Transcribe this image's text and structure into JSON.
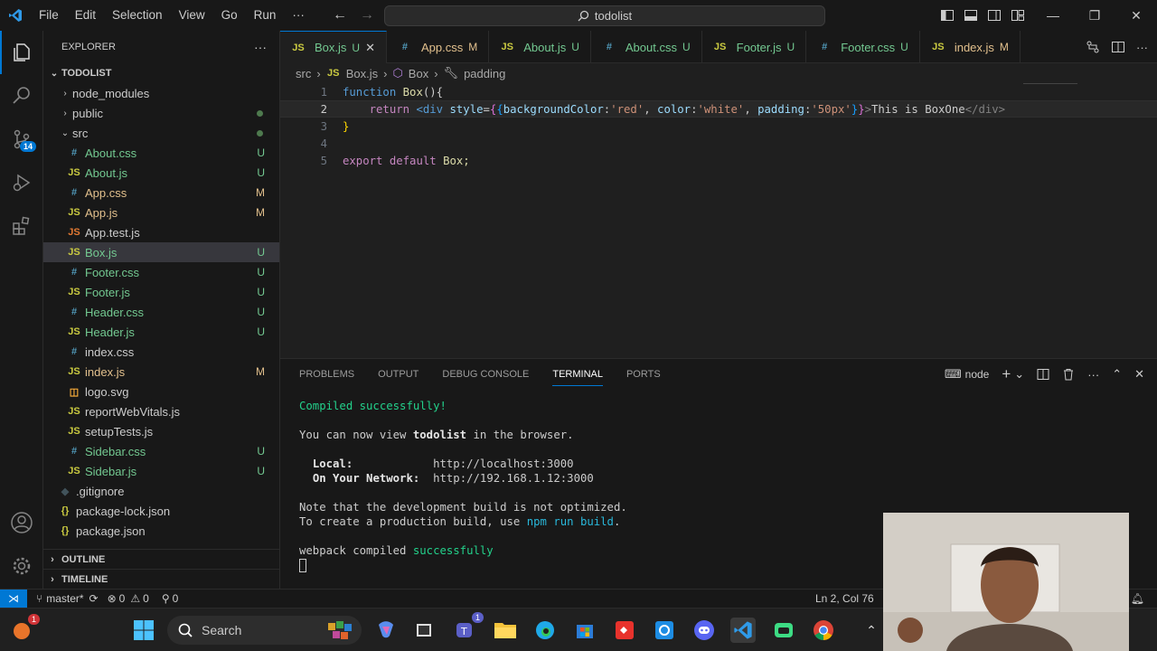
{
  "titlebar": {
    "menu": [
      "File",
      "Edit",
      "Selection",
      "View",
      "Go",
      "Run",
      "···"
    ],
    "search": "todolist"
  },
  "activity": {
    "source_control_badge": "14"
  },
  "explorer": {
    "header": "EXPLORER",
    "root": "TODOLIST",
    "items": [
      {
        "name": "node_modules",
        "type": "folder",
        "badge": ""
      },
      {
        "name": "public",
        "type": "folder",
        "badge": ""
      },
      {
        "name": "src",
        "type": "folder-open",
        "badge": ""
      },
      {
        "name": "About.css",
        "type": "css",
        "badge": "U"
      },
      {
        "name": "About.js",
        "type": "js",
        "badge": "U"
      },
      {
        "name": "App.css",
        "type": "css",
        "badge": "M"
      },
      {
        "name": "App.js",
        "type": "js",
        "badge": "M"
      },
      {
        "name": "App.test.js",
        "type": "test",
        "badge": ""
      },
      {
        "name": "Box.js",
        "type": "js",
        "badge": "U"
      },
      {
        "name": "Footer.css",
        "type": "css",
        "badge": "U"
      },
      {
        "name": "Footer.js",
        "type": "js",
        "badge": "U"
      },
      {
        "name": "Header.css",
        "type": "css",
        "badge": "U"
      },
      {
        "name": "Header.js",
        "type": "js",
        "badge": "U"
      },
      {
        "name": "index.css",
        "type": "css",
        "badge": ""
      },
      {
        "name": "index.js",
        "type": "js",
        "badge": "M"
      },
      {
        "name": "logo.svg",
        "type": "svg",
        "badge": ""
      },
      {
        "name": "reportWebVitals.js",
        "type": "js",
        "badge": ""
      },
      {
        "name": "setupTests.js",
        "type": "js",
        "badge": ""
      },
      {
        "name": "Sidebar.css",
        "type": "css",
        "badge": "U"
      },
      {
        "name": "Sidebar.js",
        "type": "js",
        "badge": "U"
      },
      {
        "name": ".gitignore",
        "type": "git",
        "badge": ""
      },
      {
        "name": "package-lock.json",
        "type": "json",
        "badge": ""
      },
      {
        "name": "package.json",
        "type": "json",
        "badge": ""
      }
    ],
    "outline": "OUTLINE",
    "timeline": "TIMELINE"
  },
  "tabs": [
    {
      "label": "Box.js",
      "type": "js",
      "status": "U"
    },
    {
      "label": "App.css",
      "type": "css",
      "status": "M"
    },
    {
      "label": "About.js",
      "type": "js",
      "status": "U"
    },
    {
      "label": "About.css",
      "type": "css",
      "status": "U"
    },
    {
      "label": "Footer.js",
      "type": "js",
      "status": "U"
    },
    {
      "label": "Footer.css",
      "type": "css",
      "status": "U"
    },
    {
      "label": "index.js",
      "type": "js",
      "status": "M"
    }
  ],
  "breadcrumb": {
    "a": "src",
    "b": "Box.js",
    "c": "Box",
    "d": "padding"
  },
  "code": {
    "l1": "1",
    "l2": "2",
    "l3": "3",
    "l4": "4",
    "l5": "5",
    "kw_function": "function",
    "fn_name": "Box",
    "fn_tail": "(){",
    "kw_return": "return",
    "tag_open": "<div",
    "attr": "style",
    "eq": "=",
    "b1": "{",
    "b2": "{",
    "p1": "backgroundColor",
    "v1": "'red'",
    "p2": "color",
    "v2": "'white'",
    "p3": "padding",
    "v3": "'50px'",
    "b3": "}",
    "b4": "}",
    "gt": ">",
    "text": "This is BoxOne",
    "tag_close": "</div>",
    "close": "}",
    "kw_export": "export",
    "kw_default": "default",
    "exp_name": "Box;"
  },
  "panel": {
    "tabs": [
      "PROBLEMS",
      "OUTPUT",
      "DEBUG CONSOLE",
      "TERMINAL",
      "PORTS"
    ],
    "shell": "node"
  },
  "terminal": {
    "compiled": "Compiled successfully!",
    "view_pre": "You can now view ",
    "view_app": "todolist",
    "view_post": " in the browser.",
    "local_label": "Local:",
    "local_url": "http://localhost:3000",
    "network_label": "On Your Network:",
    "network_url": "http://192.168.1.12:3000",
    "note": "Note that the development build is not optimized.",
    "prod_pre": "To create a production build, use ",
    "prod_cmd": "npm run build",
    "prod_post": ".",
    "webpack_pre": "webpack compiled ",
    "webpack_ok": "successfully"
  },
  "status": {
    "branch": "master*",
    "errors": "0",
    "warnings": "0",
    "ports": "0",
    "position": "Ln 2, Col 76"
  },
  "taskbar": {
    "search": "Search",
    "notif_badge": "1",
    "teams_badge": "1"
  }
}
